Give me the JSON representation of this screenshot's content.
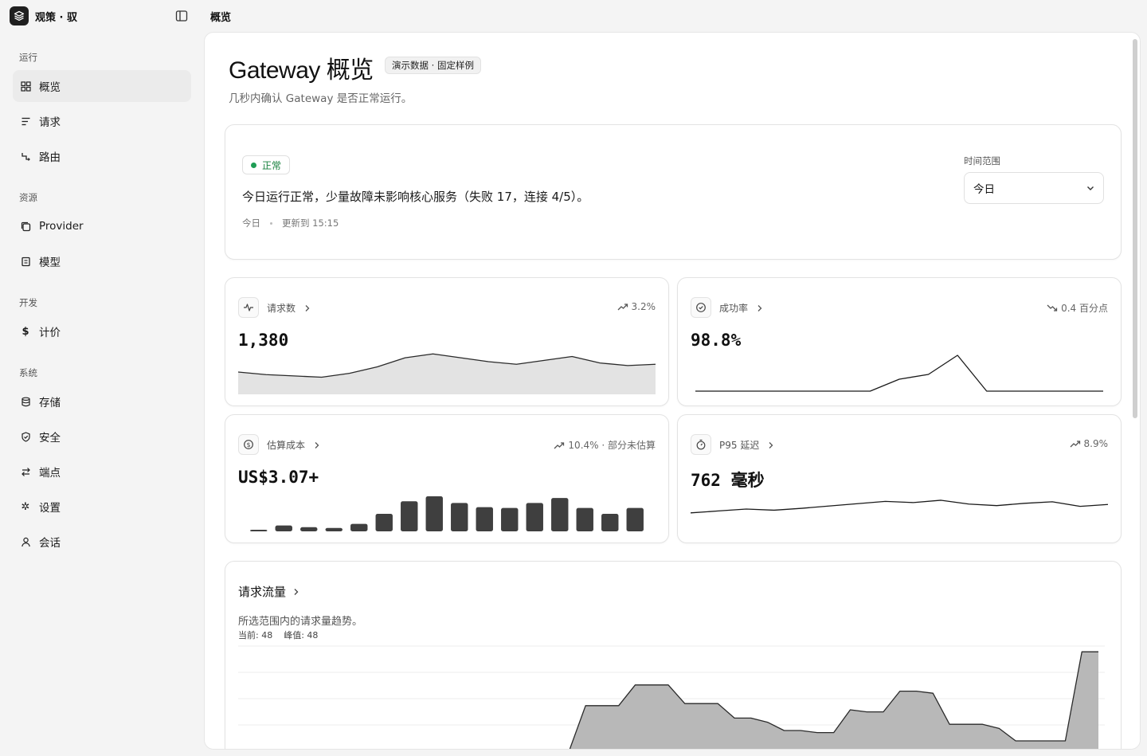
{
  "brand": {
    "name": "观策 · 驭",
    "logo_icon": "layers-icon"
  },
  "topbar": {
    "title": "概览"
  },
  "sidebar": {
    "sections": [
      {
        "title": "运行",
        "items": [
          {
            "label": "概览",
            "icon": "grid-icon",
            "active": true
          },
          {
            "label": "请求",
            "icon": "list-icon"
          },
          {
            "label": "路由",
            "icon": "route-icon"
          }
        ]
      },
      {
        "title": "资源",
        "items": [
          {
            "label": "Provider",
            "icon": "copy-icon"
          },
          {
            "label": "模型",
            "icon": "file-icon"
          }
        ]
      },
      {
        "title": "开发",
        "items": [
          {
            "label": "计价",
            "icon": "dollar-icon"
          }
        ]
      },
      {
        "title": "系统",
        "items": [
          {
            "label": "存储",
            "icon": "database-icon"
          },
          {
            "label": "安全",
            "icon": "shield-icon"
          },
          {
            "label": "端点",
            "icon": "swap-icon"
          },
          {
            "label": "设置",
            "icon": "gear-icon"
          },
          {
            "label": "会话",
            "icon": "user-icon"
          }
        ]
      }
    ]
  },
  "page": {
    "title": "Gateway 概览",
    "badge": "演示数据 · 固定样例",
    "subtitle": "几秒内确认 Gateway 是否正常运行。"
  },
  "status": {
    "badge": "正常",
    "status_color": "#1f9d55",
    "message": "今日运行正常，少量故障未影响核心服务（失败 17，连接 4/5）。",
    "range_text": "今日",
    "updated": "更新到 15:15",
    "time_range_label": "时间范围",
    "time_range_value": "今日"
  },
  "metrics": {
    "requests": {
      "label": "请求数",
      "icon": "activity-icon",
      "trend": "3.2%",
      "trend_dir": "up",
      "value": "1,380",
      "chart_data": {
        "type": "area",
        "values": [
          16,
          14,
          13,
          12,
          15,
          20,
          27,
          30,
          27,
          24,
          22,
          25,
          28,
          23,
          21,
          22
        ]
      }
    },
    "success": {
      "label": "成功率",
      "icon": "check-circle-icon",
      "trend": "0.4 百分点",
      "trend_dir": "down",
      "value": "98.8%",
      "chart_data": {
        "type": "line",
        "values": [
          98.8,
          98.8,
          98.8,
          98.8,
          98.8,
          98.8,
          98.8,
          99.05,
          99.15,
          99.55,
          98.8,
          98.8,
          98.8,
          98.8,
          98.8
        ]
      }
    },
    "cost": {
      "label": "估算成本",
      "icon": "dollar-circle-icon",
      "trend": "10.4% · 部分未估算",
      "trend_dir": "up",
      "value": "US$3.07+",
      "chart_data": {
        "type": "bar",
        "values": [
          1,
          7,
          5,
          4,
          9,
          21,
          36,
          42,
          34,
          29,
          28,
          34,
          40,
          28,
          21,
          28
        ]
      }
    },
    "latency": {
      "label": "P95 延迟",
      "icon": "timer-icon",
      "trend": "8.9%",
      "trend_dir": "up",
      "value": "762 毫秒",
      "chart_data": {
        "type": "line",
        "values": [
          740,
          745,
          750,
          747,
          752,
          758,
          764,
          770,
          767,
          773,
          763,
          759,
          765,
          769,
          757,
          762
        ]
      }
    }
  },
  "traffic": {
    "title": "请求流量",
    "subtitle": "所选范围内的请求量趋势。",
    "current_label": "当前: 48",
    "peak_label": "峰值: 48",
    "chart_data": {
      "type": "area",
      "ylim": [
        0,
        50
      ],
      "values": [
        0,
        0,
        0,
        0,
        0,
        0,
        0,
        0,
        0,
        0,
        0,
        0,
        0,
        0,
        0,
        0,
        0,
        0,
        0,
        0,
        0,
        22,
        22,
        22,
        32,
        32,
        32,
        23,
        23,
        23,
        16,
        16,
        14,
        10,
        10,
        9,
        9,
        20,
        19,
        19,
        29,
        29,
        28,
        13,
        13,
        13,
        11,
        5,
        5,
        5,
        5,
        48,
        48
      ]
    }
  }
}
